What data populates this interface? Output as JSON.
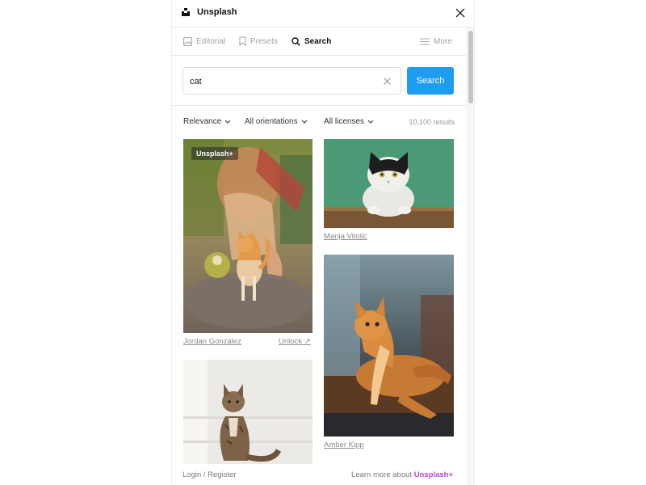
{
  "window": {
    "title": "Unsplash"
  },
  "tabs": [
    {
      "label": "Editorial",
      "icon": "image-icon",
      "active": false
    },
    {
      "label": "Presets",
      "icon": "bookmark-icon",
      "active": false
    },
    {
      "label": "Search",
      "icon": "search-icon",
      "active": true
    },
    {
      "label": "More",
      "icon": "menu-icon",
      "active": false
    }
  ],
  "search": {
    "value": "cat",
    "button_label": "Search"
  },
  "filters": {
    "sort": "Relevance",
    "orientation": "All orientations",
    "license": "All licenses",
    "results": "10,100 results"
  },
  "photos": [
    {
      "author": "Jordan González",
      "badge": "Unsplash+",
      "action": "Unlock ↗"
    },
    {
      "author": "Manja Vitolic"
    },
    {
      "author": "Amber Kipp"
    },
    {
      "author": ""
    }
  ],
  "footer": {
    "login": "Login / Register",
    "learn_prefix": "Learn more about ",
    "learn_brand": "Unsplash+"
  },
  "colors": {
    "accent": "#1e9cf0",
    "brand_plus": "#b24ad6"
  }
}
